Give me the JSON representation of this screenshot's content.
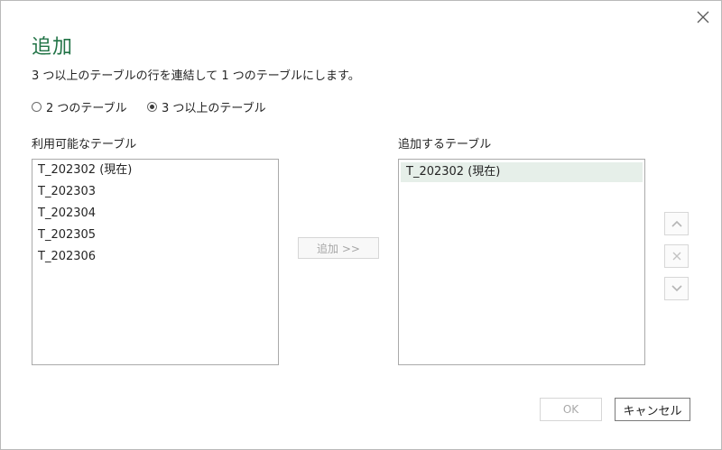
{
  "dialog": {
    "title": "追加",
    "description": "3 つ以上のテーブルの行を連結して 1 つのテーブルにします。"
  },
  "mode_options": [
    {
      "label": "2 つのテーブル",
      "selected": false
    },
    {
      "label": "3 つ以上のテーブル",
      "selected": true
    }
  ],
  "available": {
    "label": "利用可能なテーブル",
    "items": [
      "T_202302 (現在)",
      "T_202303",
      "T_202304",
      "T_202305",
      "T_202306"
    ]
  },
  "add_button_label": "追加 >>",
  "to_append": {
    "label": "追加するテーブル",
    "items": [
      "T_202302 (現在)"
    ]
  },
  "side_buttons": [
    "chevron-up-icon",
    "remove-x-icon",
    "chevron-down-icon"
  ],
  "footer": {
    "ok_label": "OK",
    "cancel_label": "キャンセル"
  },
  "colors": {
    "title": "#217346",
    "selection": "#e6efe9"
  }
}
